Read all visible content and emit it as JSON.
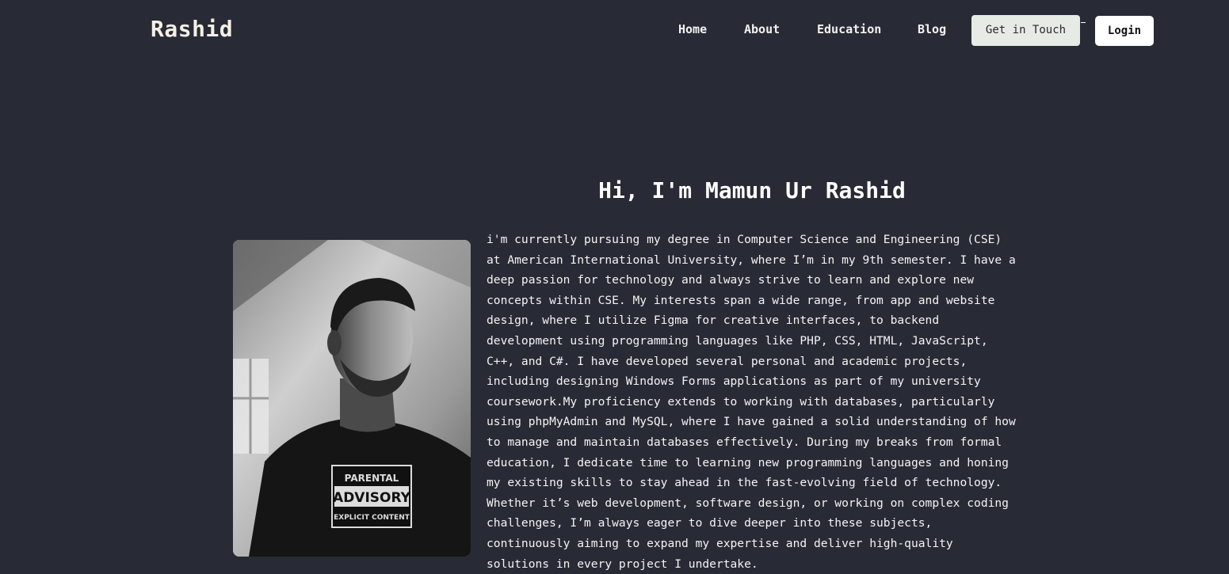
{
  "navbar": {
    "brand": "Rashid",
    "links": [
      "Home",
      "About",
      "Education",
      "Blog"
    ],
    "cta_label": "Get in Touch",
    "login_label": "Login"
  },
  "hero": {
    "title": "Hi, I'm Mamun Ur Rashid",
    "portrait_tshirt_text": [
      "PARENTAL",
      "ADVISORY",
      "EXPLICIT CONTENT"
    ],
    "bio_lines": [
      "i'm currently pursuing my degree in Computer Science and Engineering (CSE)",
      "at American International University, where I’m in my 9th semester. I have a",
      "deep passion for technology and always strive to learn and explore new",
      "concepts within CSE. My interests span a wide range, from app and website",
      "design, where I utilize Figma for creative interfaces, to backend",
      "development using programming languages like PHP, CSS, HTML, JavaScript,",
      "C++, and C#. I have developed several personal and academic projects,",
      "including designing Windows Forms applications as part of my university",
      "coursework.My proficiency extends to working with databases, particularly",
      "using phpMyAdmin and MySQL, where I have gained a solid understanding of how",
      "to manage and maintain databases effectively. During my breaks from formal",
      "education, I dedicate time to learning new programming languages and honing",
      "my existing skills to stay ahead in the fast-evolving field of technology.",
      "Whether it’s web development, software design, or working on complex coding",
      "challenges, I’m always eager to dive deeper into these subjects,",
      "continuously aiming to expand my expertise and deliver high-quality",
      "solutions in every project I undertake."
    ]
  },
  "colors": {
    "background": "#282b35",
    "cta_bg": "#e7ebe5",
    "login_bg": "#ffffff",
    "text": "#ffffff"
  }
}
